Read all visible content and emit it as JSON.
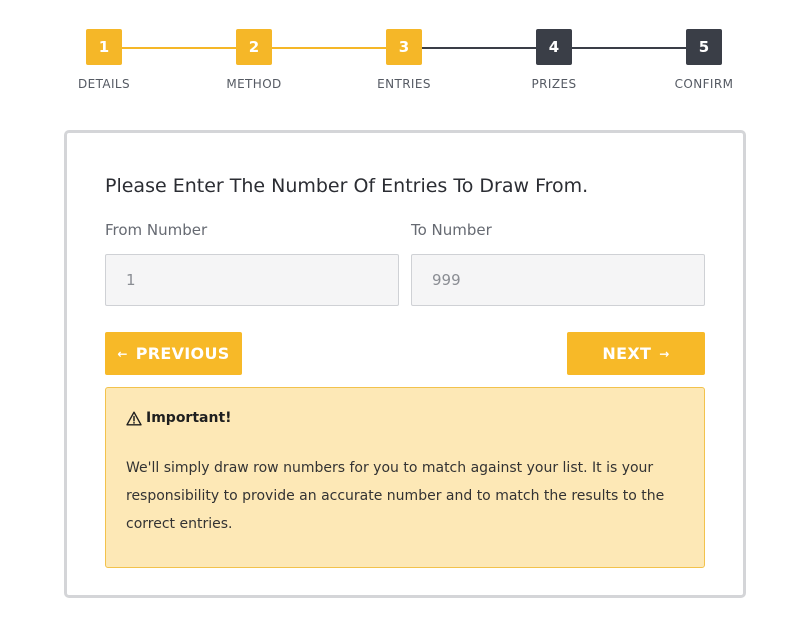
{
  "stepper": {
    "steps": [
      {
        "number": "1",
        "label": "DETAILS",
        "state": "complete"
      },
      {
        "number": "2",
        "label": "METHOD",
        "state": "complete"
      },
      {
        "number": "3",
        "label": "ENTRIES",
        "state": "current"
      },
      {
        "number": "4",
        "label": "PRIZES",
        "state": "upcoming"
      },
      {
        "number": "5",
        "label": "CONFIRM",
        "state": "upcoming"
      }
    ]
  },
  "form": {
    "title": "Please Enter The Number Of Entries To Draw From.",
    "from_label": "From Number",
    "from_value": "1",
    "to_label": "To Number",
    "to_value": "999"
  },
  "buttons": {
    "previous_label": "PREVIOUS",
    "previous_icon": "arrow-left-icon",
    "next_label": "NEXT",
    "next_icon": "arrow-right-icon"
  },
  "notice": {
    "icon": "warning-icon",
    "heading": "Important!",
    "text": "We'll simply draw row numbers for you to match against your list. It is your responsibility to provide an accurate number and to match the results to the correct entries."
  },
  "colors": {
    "accent": "#f7b928",
    "step_upcoming": "#3a3e47",
    "notice_bg": "#fde8b6",
    "notice_border": "#f2c24c"
  }
}
